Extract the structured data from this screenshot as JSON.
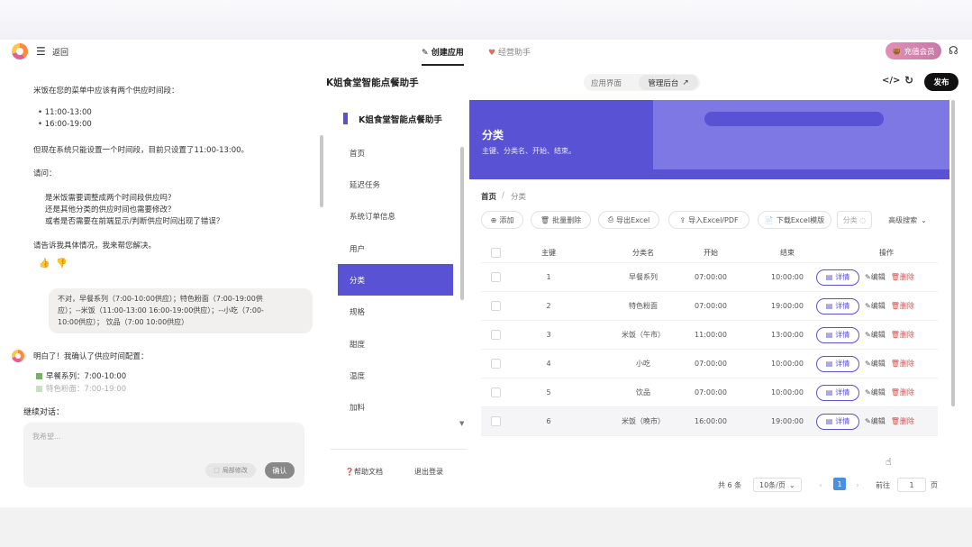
{
  "topbar": {
    "back_label": "返回",
    "tab_build": "创建应用",
    "tab_ops": "经营助手",
    "vip_label": "充值会员"
  },
  "chat": {
    "msg_intro": "米饭在您的菜单中应该有两个供应时间段：",
    "msg_slot1": "• 11:00-13:00",
    "msg_slot2": "• 16:00-19:00",
    "msg_problem": "但现在系统只能设置一个时间段，目前只设置了11:00-13:00。",
    "msg_ask": "请问：",
    "msg_q1": "是米饭需要调整成两个时间段供应吗？",
    "msg_q2": "还是其他分类的供应时间也需要修改？",
    "msg_q3": "或者是否需要在前端显示/判断供应时间出现了错误？",
    "msg_end": "请告诉我具体情况，我来帮您解决。",
    "user_line1": "不对，早餐系列（7:00-10:00供应）；特色粉面（7:00-19:00供",
    "user_line2": "应）；--米饭（11:00-13:00 16:00-19:00供应）；--小吃（7:00-",
    "user_line3": "10:00供应）；   饮品（7:00  10:00供应）",
    "ai_reply": "明白了！我确认了供应时间配置：",
    "ai_item1": "早餐系列：7:00-10:00",
    "ai_item2": "特色粉面：7:00-19:00",
    "continue_label": "继续对话：",
    "input_placeholder": "我希望...",
    "partial_edit_label": "局部修改",
    "confirm_label": "确认"
  },
  "header": {
    "app_title": "K姐食堂智能点餐助手",
    "view_app": "应用界面",
    "view_admin": "管理后台",
    "publish_label": "发布"
  },
  "sidebar": {
    "title": "K姐食堂智能点餐助手",
    "items": [
      {
        "label": "首页"
      },
      {
        "label": "延迟任务"
      },
      {
        "label": "系统订单信息"
      },
      {
        "label": "用户"
      },
      {
        "label": "分类"
      },
      {
        "label": "规格"
      },
      {
        "label": "甜度"
      },
      {
        "label": "温度"
      },
      {
        "label": "加料"
      }
    ],
    "help_label": "帮助文档",
    "logout_label": "退出登录"
  },
  "main": {
    "banner_title": "分类",
    "banner_subtitle": "主键、分类名、开始、结束。",
    "crumb_home": "首页",
    "crumb_sep": "/",
    "crumb_current": "分类",
    "toolbar": {
      "add": "添加",
      "batch_delete": "批量删除",
      "export_excel": "导出Excel",
      "import": "导入Excel/PDF",
      "download_template": "下载Excel模版",
      "search_placeholder": "分类",
      "advanced_search": "高级搜索"
    },
    "columns": {
      "id": "主键",
      "name": "分类名",
      "start": "开始",
      "end": "结束",
      "ops": "操作"
    },
    "rows": [
      {
        "id": "1",
        "name": "早餐系列",
        "start": "07:00:00",
        "end": "10:00:00"
      },
      {
        "id": "2",
        "name": "特色粉面",
        "start": "07:00:00",
        "end": "19:00:00"
      },
      {
        "id": "3",
        "name": "米饭（午市）",
        "start": "11:00:00",
        "end": "13:00:00"
      },
      {
        "id": "4",
        "name": "小吃",
        "start": "07:00:00",
        "end": "10:00:00"
      },
      {
        "id": "5",
        "name": "饮品",
        "start": "07:00:00",
        "end": "10:00:00"
      },
      {
        "id": "6",
        "name": "米饭（晚市）",
        "start": "16:00:00",
        "end": "19:00:00"
      }
    ],
    "row_actions": {
      "detail": "详情",
      "edit": "编辑",
      "delete": "删除"
    },
    "pagination": {
      "total": "共 6 条",
      "page_size": "10条/页",
      "prev": "‹",
      "current": "1",
      "next": "›",
      "goto_label": "前往",
      "goto_value": "1",
      "page_unit": "页"
    }
  }
}
